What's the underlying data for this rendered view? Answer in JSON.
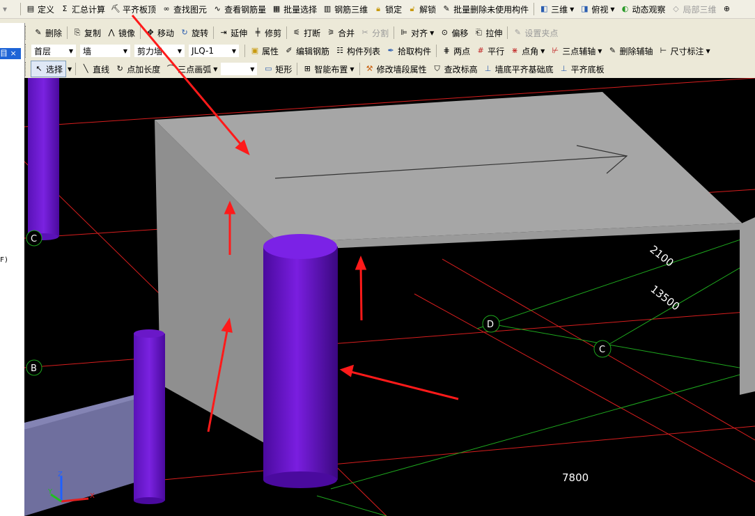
{
  "menu": {
    "items": [
      {
        "label": "定义",
        "icon": "define-icon"
      },
      {
        "label": "汇总计算",
        "icon": "sigma-icon"
      },
      {
        "label": "平齐板顶",
        "icon": "align-top-icon"
      },
      {
        "label": "查找图元",
        "icon": "binoculars-icon"
      },
      {
        "label": "查看钢筋量",
        "icon": "rebar-icon"
      },
      {
        "label": "批量选择",
        "icon": "batch-select-icon"
      },
      {
        "label": "钢筋三维",
        "icon": "rebar-3d-icon"
      },
      {
        "label": "锁定",
        "icon": "lock-icon"
      },
      {
        "label": "解锁",
        "icon": "unlock-icon"
      },
      {
        "label": "批量删除未使用构件",
        "icon": "batch-delete-icon"
      },
      {
        "label": "三维",
        "icon": "cube-icon"
      },
      {
        "label": "俯视",
        "icon": "top-view-icon"
      },
      {
        "label": "动态观察",
        "icon": "orbit-icon"
      },
      {
        "label": "局部三维",
        "icon": "local-3d-icon"
      }
    ]
  },
  "edit_toolbar": {
    "items": [
      {
        "label": "删除"
      },
      {
        "label": "复制"
      },
      {
        "label": "镜像"
      },
      {
        "label": "移动"
      },
      {
        "label": "旋转"
      },
      {
        "label": "延伸"
      },
      {
        "label": "修剪"
      },
      {
        "label": "打断"
      },
      {
        "label": "合并"
      },
      {
        "label": "分割"
      },
      {
        "label": "对齐"
      },
      {
        "label": "偏移"
      },
      {
        "label": "拉伸"
      },
      {
        "label": "设置夹点"
      }
    ]
  },
  "component_toolbar": {
    "floor": "首层",
    "type": "墙",
    "subtype": "剪力墙",
    "component": "JLQ-1",
    "items": [
      {
        "label": "属性"
      },
      {
        "label": "编辑钢筋"
      },
      {
        "label": "构件列表"
      },
      {
        "label": "拾取构件"
      },
      {
        "label": "两点"
      },
      {
        "label": "平行"
      },
      {
        "label": "点角"
      },
      {
        "label": "三点辅轴"
      },
      {
        "label": "删除辅轴"
      },
      {
        "label": "尺寸标注"
      }
    ]
  },
  "draw_toolbar": {
    "items": [
      {
        "label": "选择"
      },
      {
        "label": "直线"
      },
      {
        "label": "点加长度"
      },
      {
        "label": "三点画弧"
      },
      {
        "label": ""
      },
      {
        "label": "矩形"
      },
      {
        "label": "智能布置"
      },
      {
        "label": "修改墙段属性"
      },
      {
        "label": "查改标高"
      },
      {
        "label": "墙底平齐基础底"
      },
      {
        "label": "平齐底板"
      }
    ]
  },
  "left_panel": {
    "tab_label": "目 ×",
    "partial_text": "F)"
  },
  "viewport": {
    "axis_labels": {
      "b": "B",
      "c": "C",
      "d": "D",
      "c_top": "C"
    },
    "dimensions": {
      "d1": "2100",
      "d2": "13500",
      "d3": "7800"
    },
    "axes": {
      "x": "X",
      "y": "Y",
      "z": "Z"
    }
  },
  "colors": {
    "wall": "#a6a6a6",
    "column": "#6b12c8",
    "grid_red": "#e02020",
    "grid_green": "#20c020",
    "arrow": "#ff1a1a"
  }
}
